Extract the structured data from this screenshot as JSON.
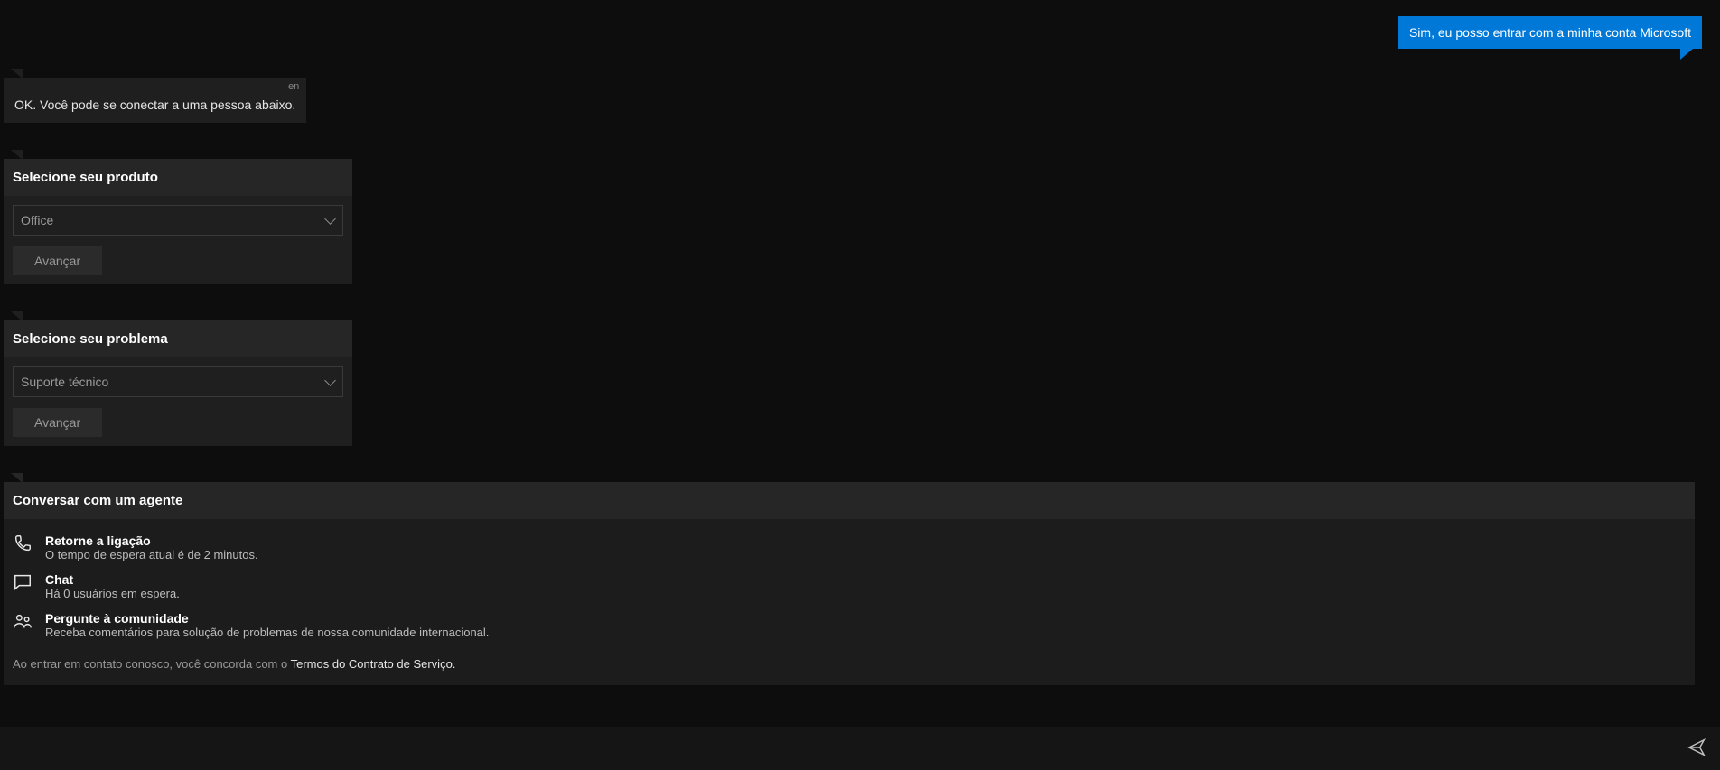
{
  "user_message": "Sim, eu posso entrar com a minha conta Microsoft",
  "bot_reply": {
    "lang_tag": "en",
    "text": "OK. Você pode se conectar a uma pessoa abaixo."
  },
  "product_card": {
    "title": "Selecione seu produto",
    "selected": "Office",
    "button": "Avançar"
  },
  "problem_card": {
    "title": "Selecione seu problema",
    "selected": "Suporte técnico",
    "button": "Avançar"
  },
  "agent_panel": {
    "title": "Conversar com um agente",
    "options": [
      {
        "icon": "phone",
        "title": "Retorne a ligação",
        "sub": "O tempo de espera atual é de 2 minutos."
      },
      {
        "icon": "chat",
        "title": "Chat",
        "sub": "Há 0 usuários em espera."
      },
      {
        "icon": "community",
        "title": "Pergunte à comunidade",
        "sub": "Receba comentários para solução de problemas de nossa comunidade internacional."
      }
    ],
    "legal_prefix": "Ao entrar em contato conosco, você concorda com o ",
    "legal_link": "Termos do Contrato de Serviço."
  },
  "input": {
    "placeholder": ""
  }
}
